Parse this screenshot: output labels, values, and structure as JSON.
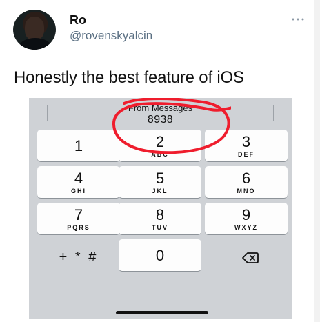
{
  "tweet": {
    "display_name": "Ro",
    "handle": "@rovenskyalcin",
    "text": "Honestly the best feature of iOS",
    "more_icon": "ellipsis-icon",
    "avatar_icon": "profile-avatar"
  },
  "phone": {
    "suggestion": {
      "label": "From Messages",
      "value": "8938"
    },
    "keys": [
      {
        "digit": "1",
        "letters": ""
      },
      {
        "digit": "2",
        "letters": "ABC"
      },
      {
        "digit": "3",
        "letters": "DEF"
      },
      {
        "digit": "4",
        "letters": "GHI"
      },
      {
        "digit": "5",
        "letters": "JKL"
      },
      {
        "digit": "6",
        "letters": "MNO"
      },
      {
        "digit": "7",
        "letters": "PQRS"
      },
      {
        "digit": "8",
        "letters": "TUV"
      },
      {
        "digit": "9",
        "letters": "WXYZ"
      },
      {
        "digit": "0",
        "letters": ""
      }
    ],
    "symbol_key": "+ * #",
    "delete_icon": "delete-backspace-icon",
    "home_indicator": "home-indicator"
  },
  "colors": {
    "background": "#ffffff",
    "keyboard_background": "#cfd2d6",
    "key_background": "#fdfdfd",
    "annotation_red": "#ef1d2d",
    "handle_gray": "#5b7083"
  }
}
